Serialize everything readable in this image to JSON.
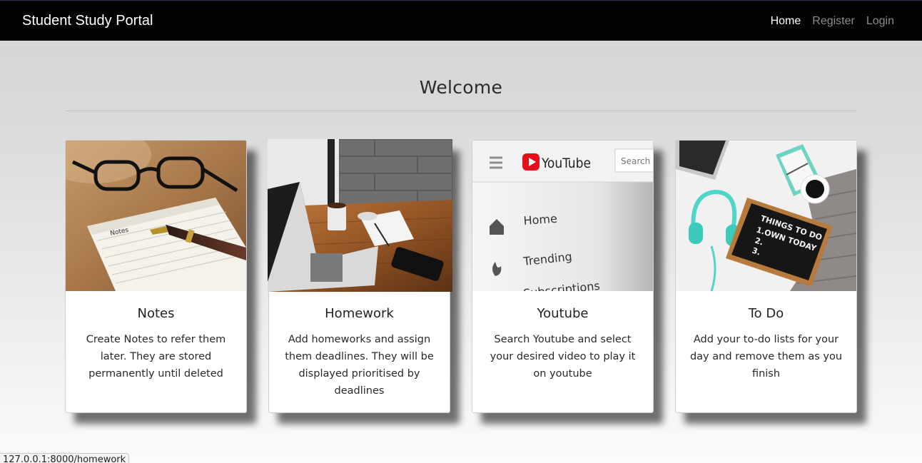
{
  "navbar": {
    "brand": "Student Study Portal",
    "links": [
      {
        "label": "Home",
        "active": true
      },
      {
        "label": "Register",
        "active": false
      },
      {
        "label": "Login",
        "active": false
      }
    ]
  },
  "main": {
    "heading": "Welcome"
  },
  "cards": [
    {
      "title": "Notes",
      "text": "Create Notes to refer them later. They are stored permanently until deleted",
      "image": {
        "handwritten": "Notes"
      }
    },
    {
      "title": "Homework",
      "text": "Add homeworks and assign them deadlines. They will be displayed prioritised by deadlines",
      "image": {}
    },
    {
      "title": "Youtube",
      "text": "Search Youtube and select your desired video to play it on youtube",
      "image": {
        "logo_text": "YouTube",
        "search_text": "Search",
        "menu_items": [
          "Home",
          "Trending",
          "Subscriptions"
        ]
      }
    },
    {
      "title": "To Do",
      "text": "Add your to-do lists for your day and remove them as you finish",
      "image": {
        "board_lines": [
          "THINGS TO DO",
          "1.OWN TODAY",
          "2.",
          "3."
        ]
      }
    }
  ],
  "status_bar": {
    "url": "127.0.0.1:8000/homework"
  }
}
